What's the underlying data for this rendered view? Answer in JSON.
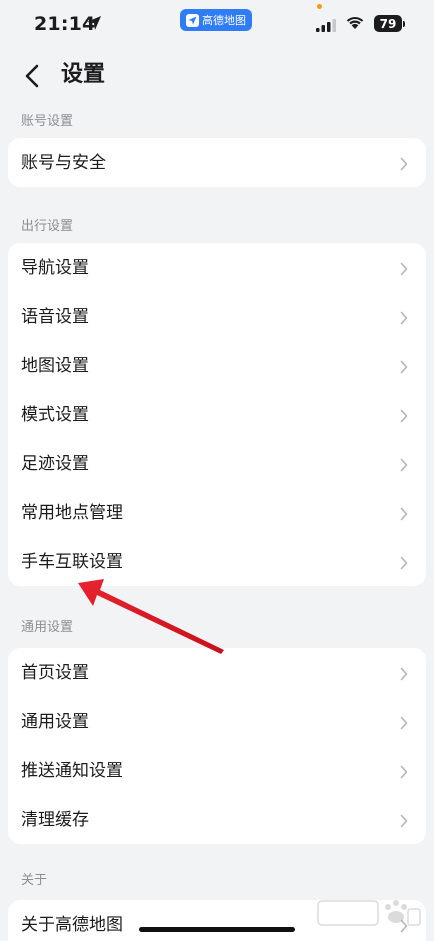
{
  "status_bar": {
    "time": "21:14",
    "app_pill_label": "高德地图",
    "battery": "79"
  },
  "nav": {
    "title": "设置"
  },
  "sections": [
    {
      "header": "账号设置",
      "items": [
        "账号与安全"
      ]
    },
    {
      "header": "出行设置",
      "items": [
        "导航设置",
        "语音设置",
        "地图设置",
        "模式设置",
        "足迹设置",
        "常用地点管理",
        "手车互联设置"
      ]
    },
    {
      "header": "通用设置",
      "items": [
        "首页设置",
        "通用设置",
        "推送通知设置",
        "清理缓存"
      ]
    },
    {
      "header": "关于",
      "items": [
        "关于高德地图"
      ]
    }
  ],
  "colors": {
    "background": "#f2f3f5",
    "card": "#ffffff",
    "annotation_arrow": "#e8242f",
    "app_pill": "#2f7cf6"
  },
  "icons": [
    "location-arrow-icon",
    "signal-icon",
    "wifi-icon",
    "back-icon",
    "chevron-right-icon",
    "baidu-watermark-icon"
  ]
}
